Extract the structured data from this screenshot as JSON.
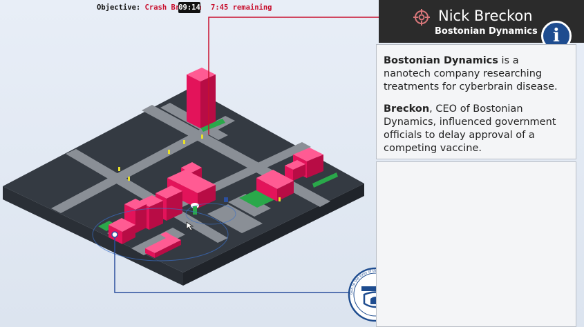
{
  "hud": {
    "objective_label": "Objective:",
    "objective_value": "Crash Breckon",
    "clock": "09:14",
    "remaining": "7:45 remaining"
  },
  "target": {
    "name": "Nick Breckon",
    "company": "Bostonian Dynamics",
    "info_icon": "i"
  },
  "info": {
    "p1_bold": "Bostonian Dynamics",
    "p1_rest": " is a nanotech company researching treatments for cyberbrain disease.",
    "p2_bold": "Breckon",
    "p2_rest": ", CEO of Bostonian Dynamics, influenced government officials to delay approval of a competing vaccine."
  },
  "badge": {
    "text": "Gun to the eyes of the hipsters · Bitterbird of a cyberpunk world ·"
  },
  "colors": {
    "building": "#f0145f",
    "ground": "#3a3f47",
    "road": "#8a8f96",
    "park": "#2aa84a",
    "accent_red": "#c8102e",
    "link_blue": "#2b4f9e"
  }
}
